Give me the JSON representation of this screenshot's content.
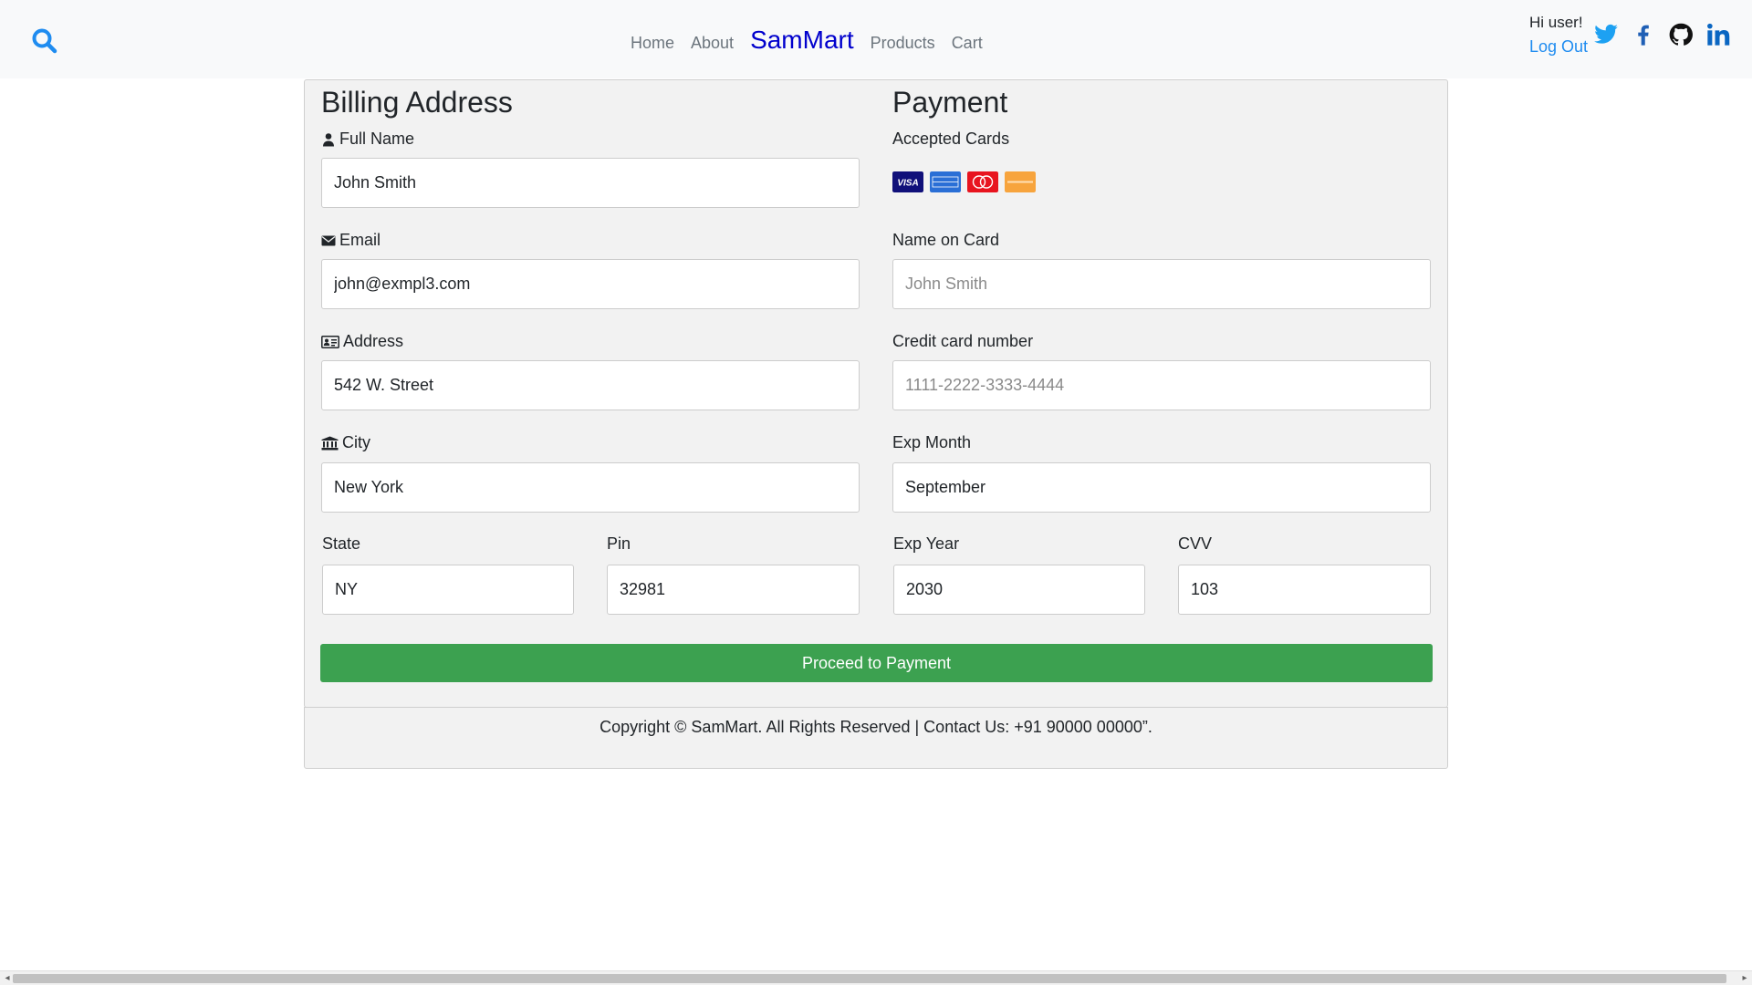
{
  "nav": {
    "links": [
      "Home",
      "About"
    ],
    "brand": "SamMart",
    "links_right": [
      "Products",
      "Cart"
    ],
    "greeting": "Hi user!",
    "logout": "Log Out",
    "social_icons": [
      "twitter-icon",
      "facebook-icon",
      "github-icon",
      "linkedin-icon"
    ],
    "search_icon": "search-icon"
  },
  "billing": {
    "title": "Billing Address",
    "full_name_label": "Full Name",
    "full_name_value": "John Smith",
    "email_label": "Email",
    "email_value": "john@exmpl3.com",
    "address_label": "Address",
    "address_value": "542 W. Street",
    "city_label": "City",
    "city_value": "New York",
    "state_label": "State",
    "state_value": "NY",
    "pin_label": "Pin",
    "pin_value": "32981"
  },
  "payment": {
    "title": "Payment",
    "accepted_label": "Accepted Cards",
    "cards": [
      "visa",
      "amex",
      "mastercard",
      "discover"
    ],
    "name_label": "Name on Card",
    "name_placeholder": "John Smith",
    "card_number_label": "Credit card number",
    "card_number_placeholder": "1111-2222-3333-4444",
    "exp_month_label": "Exp Month",
    "exp_month_value": "September",
    "exp_year_label": "Exp Year",
    "exp_year_value": "2030",
    "cvv_label": "CVV",
    "cvv_value": "103"
  },
  "submit_label": "Proceed to Payment",
  "footer": {
    "text": "Copyright © SamMart. All Rights Reserved | Contact Us: +91 90000 00000”."
  },
  "colors": {
    "brand": "#0000cd",
    "link": "#1f8cf0",
    "button": "#3ca150"
  }
}
